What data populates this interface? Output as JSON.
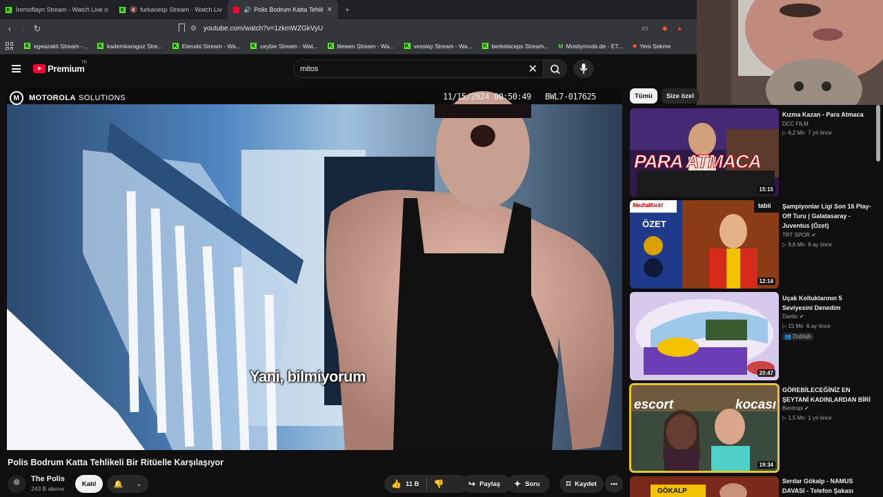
{
  "browser": {
    "tabs": [
      {
        "label": "İremoflayn Stream - Watch Live on Ki",
        "favicon": "kick-icon",
        "active": false
      },
      {
        "label": "furkanesp Stream - Watch Live o",
        "favicon": "kick-icon",
        "muted": true,
        "active": false
      },
      {
        "label": "Polis Bodrum Katta Tehlikeli B",
        "favicon": "youtube-icon",
        "audio": true,
        "active": true
      }
    ],
    "new_tab": "+",
    "url": "youtube.com/watch?v=1zkmWZGkVyU",
    "bookmarks": [
      {
        "label": "egeazakli Stream -...",
        "icon": "kick-icon"
      },
      {
        "label": "kademkaragoz Stre...",
        "icon": "kick-icon"
      },
      {
        "label": "Eienabi Stream - Wa...",
        "icon": "kick-icon"
      },
      {
        "label": "ceybie Stream - Wat...",
        "icon": "kick-icon"
      },
      {
        "label": "lliewen Stream - Wa...",
        "icon": "kick-icon"
      },
      {
        "label": "vesslay Stream - Wa...",
        "icon": "kick-icon"
      },
      {
        "label": "berkebiceps Stream...",
        "icon": "kick-icon"
      },
      {
        "label": "Mosbymods.de - ET...",
        "icon": "mosby-icon"
      },
      {
        "label": "Yeni Sekme",
        "icon": "brave-icon"
      }
    ]
  },
  "header": {
    "logo_text": "Premium",
    "country_code": "TR",
    "search_value": "mitos"
  },
  "video": {
    "brand": "MOTOROLA",
    "brand_suffix": "SOLUTIONS",
    "timestamp": "11/15/2024 00:50:49",
    "camera_id": "BWL7-017625",
    "subtitle": "Yani, bilmiyorum",
    "title": "Polis Bodrum Katta Tehlikeli Bir Ritüelle Karşılaşıyor"
  },
  "channel": {
    "name": "The Polis",
    "subscribers": "243 B abone",
    "join_label": "Katıl"
  },
  "actions": {
    "likes": "11 B",
    "share": "Paylaş",
    "ask": "Soru",
    "save": "Kaydet"
  },
  "sidebar": {
    "chips": [
      "Tümü",
      "Size özel"
    ],
    "recommendations": [
      {
        "title": "Kızma Kazan - Para Atmaca",
        "channel": "DCC FILM",
        "verified": false,
        "views": "6,2 Mn",
        "age": "7 yıl önce",
        "duration": "15:15"
      },
      {
        "title": "Şampiyonlar Ligi Son 16 Play-Off Turu | Galatasaray - Juventus (Özet)",
        "channel": "TRT SPOR",
        "verified": true,
        "views": "9,6 Mn",
        "age": "6 ay önce",
        "duration": "12:14"
      },
      {
        "title": "Uçak Koltuklarının 5 Seviyesini Denedim",
        "channel": "Dantic",
        "verified": true,
        "views": "15 Mn",
        "age": "6 ay önce",
        "badge": "Dublajlı",
        "duration": "20:47"
      },
      {
        "title": "GÖREBİLECEĞİNİZ EN ŞEYTANİ KADINLARDAN BİRİ",
        "channel": "Bentropi",
        "verified": true,
        "views": "1,5 Mn",
        "age": "1 yıl önce",
        "duration": "19:34"
      },
      {
        "title": "Serdar Gökalp - NAMUS DAVASI - Telefon Şakası",
        "channel": "",
        "verified": false,
        "views": "",
        "age": "",
        "duration": ""
      }
    ],
    "thumb_texts": {
      "para_atmaca": "PARA ATMACA",
      "ozet": "ÖZET",
      "mediamarkt": "MediaMarkt",
      "tabii": "tabii",
      "escort": "escort",
      "kocasi": "kocası",
      "gokalp": "GÖKALP"
    }
  }
}
